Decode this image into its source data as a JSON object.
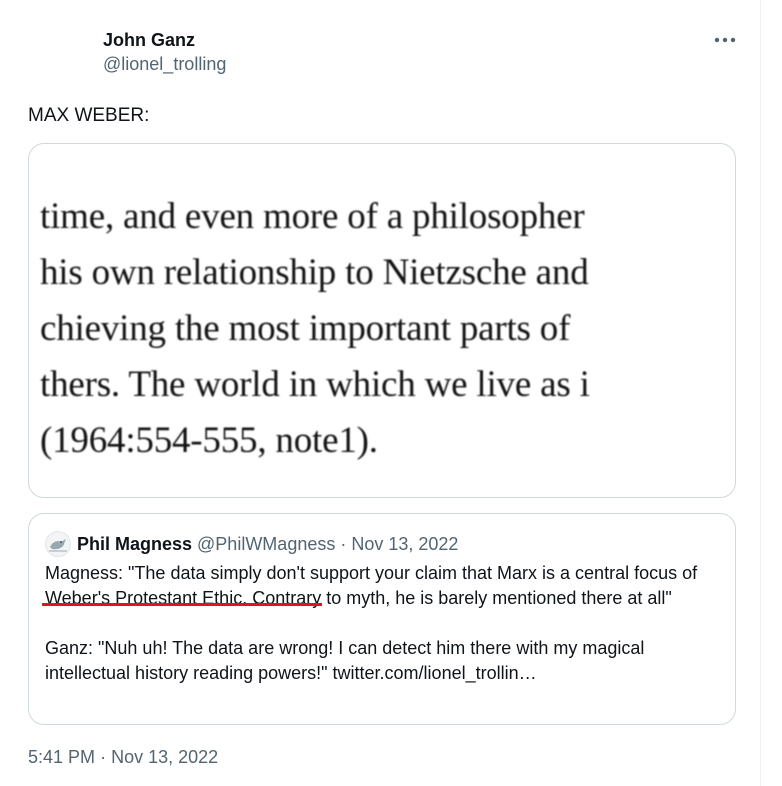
{
  "author": {
    "name": "John Ganz",
    "handle": "@lionel_trolling"
  },
  "more_icon": "more-horizontal-icon",
  "tweet_text": "MAX WEBER:",
  "media": {
    "lines": [
      "time, and even more of a philosopher",
      "his own relationship to Nietzsche and",
      "chieving the most important parts of",
      "thers. The world in which we live as i",
      "(1964:554-555, note1)."
    ]
  },
  "quote": {
    "name": "Phil Magness",
    "handle": "@PhilWMagness",
    "separator": "·",
    "date": "Nov 13, 2022",
    "paragraph1_pre": "Magness: \"The data simply don't support your claim that Marx is a central ",
    "paragraph1_highlight": "focus of Weber's Protestant Ethic",
    "paragraph1_post": ". Contrary to myth, he is barely mentioned there at all\"",
    "paragraph2": "Ganz: \"Nuh uh! The data are wrong! I can detect him there with my magical intellectual history reading powers!\" twitter.com/lionel_trollin…",
    "highlight_color": "#d9171d"
  },
  "timestamp": {
    "time": "5:41 PM",
    "separator": "·",
    "date": "Nov 13, 2022"
  }
}
